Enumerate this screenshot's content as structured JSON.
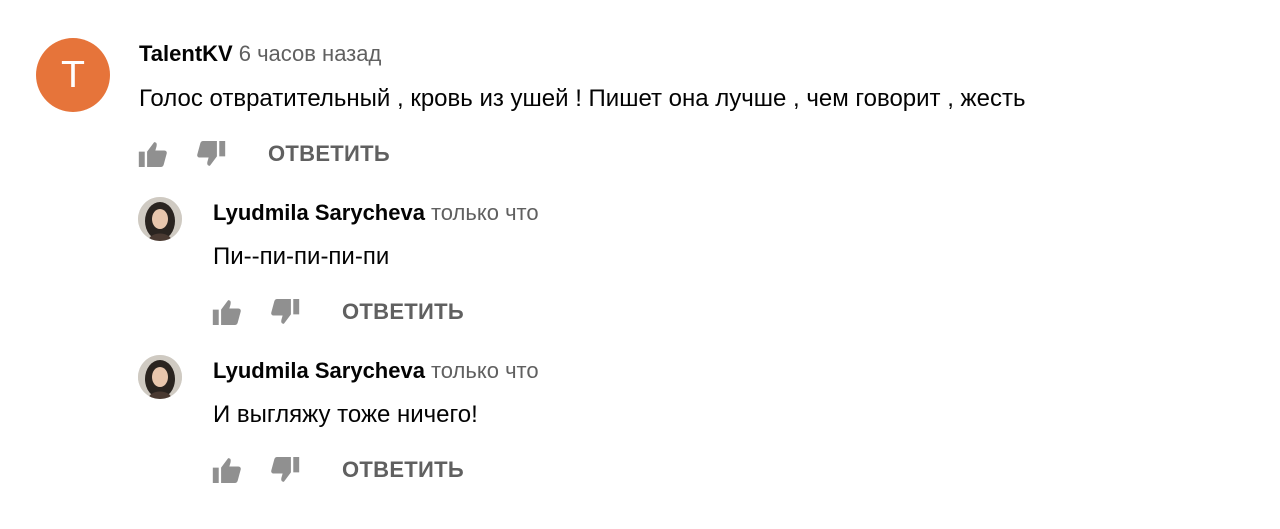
{
  "comments": [
    {
      "author": "TalentKV",
      "time": "6 часов назад",
      "text": "Голос отвратительный , кровь из ушей ! Пишет она лучше , чем говорит , жесть",
      "avatar_letter": "T",
      "avatar_color": "#e6743a",
      "reply_label": "ОТВЕТИТЬ"
    }
  ],
  "replies": [
    {
      "author": "Lyudmila Sarycheva",
      "time": "только что",
      "text": "Пи--пи-пи-пи-пи",
      "reply_label": "ОТВЕТИТЬ"
    },
    {
      "author": "Lyudmila Sarycheva",
      "time": "только что",
      "text": "И выгляжу тоже ничего!",
      "reply_label": "ОТВЕТИТЬ"
    }
  ],
  "icons": {
    "like": "thumbs-up-icon",
    "dislike": "thumbs-down-icon"
  },
  "colors": {
    "text": "#030303",
    "secondary": "#606060",
    "icon": "#909090"
  }
}
